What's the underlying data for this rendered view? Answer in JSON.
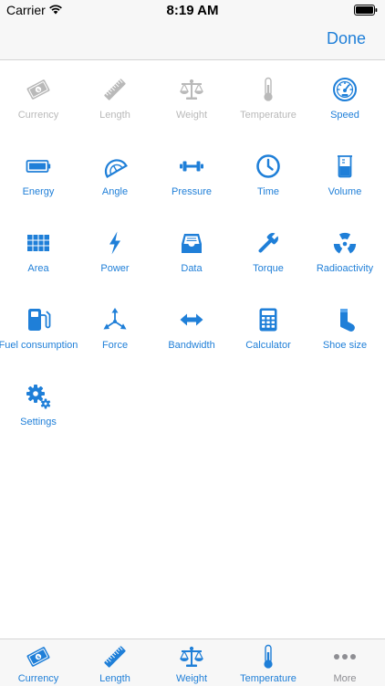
{
  "status_bar": {
    "carrier": "Carrier",
    "time": "8:19 AM"
  },
  "nav": {
    "done_label": "Done"
  },
  "accent_color": "#1f7fd8",
  "disabled_color": "#b9b9b9",
  "grid": {
    "items": [
      {
        "label": "Currency",
        "icon": "currency-icon",
        "state": "disabled"
      },
      {
        "label": "Length",
        "icon": "ruler-icon",
        "state": "disabled"
      },
      {
        "label": "Weight",
        "icon": "scale-icon",
        "state": "disabled"
      },
      {
        "label": "Temperature",
        "icon": "thermometer-icon",
        "state": "disabled"
      },
      {
        "label": "Speed",
        "icon": "speedometer-icon",
        "state": "enabled"
      },
      {
        "label": "Energy",
        "icon": "battery-icon",
        "state": "enabled"
      },
      {
        "label": "Angle",
        "icon": "protractor-icon",
        "state": "enabled"
      },
      {
        "label": "Pressure",
        "icon": "dumbbell-icon",
        "state": "enabled"
      },
      {
        "label": "Time",
        "icon": "clock-icon",
        "state": "enabled"
      },
      {
        "label": "Volume",
        "icon": "beaker-icon",
        "state": "enabled"
      },
      {
        "label": "Area",
        "icon": "grid-icon",
        "state": "enabled"
      },
      {
        "label": "Power",
        "icon": "lightning-icon",
        "state": "enabled"
      },
      {
        "label": "Data",
        "icon": "tray-icon",
        "state": "enabled"
      },
      {
        "label": "Torque",
        "icon": "wrench-icon",
        "state": "enabled"
      },
      {
        "label": "Radioactivity",
        "icon": "radiation-icon",
        "state": "enabled"
      },
      {
        "label": "Fuel consumption",
        "icon": "fuel-pump-icon",
        "state": "enabled"
      },
      {
        "label": "Force",
        "icon": "force-arrows-icon",
        "state": "enabled"
      },
      {
        "label": "Bandwidth",
        "icon": "double-arrow-icon",
        "state": "enabled"
      },
      {
        "label": "Calculator",
        "icon": "calculator-icon",
        "state": "enabled"
      },
      {
        "label": "Shoe size",
        "icon": "sock-icon",
        "state": "enabled"
      },
      {
        "label": "Settings",
        "icon": "gears-icon",
        "state": "enabled"
      }
    ]
  },
  "tab_bar": {
    "tabs": [
      {
        "label": "Currency",
        "icon": "currency-icon",
        "state": "on"
      },
      {
        "label": "Length",
        "icon": "ruler-icon",
        "state": "on"
      },
      {
        "label": "Weight",
        "icon": "scale-icon",
        "state": "on"
      },
      {
        "label": "Temperature",
        "icon": "thermometer-icon",
        "state": "on"
      },
      {
        "label": "More",
        "icon": "more-dots-icon",
        "state": "off"
      }
    ]
  }
}
